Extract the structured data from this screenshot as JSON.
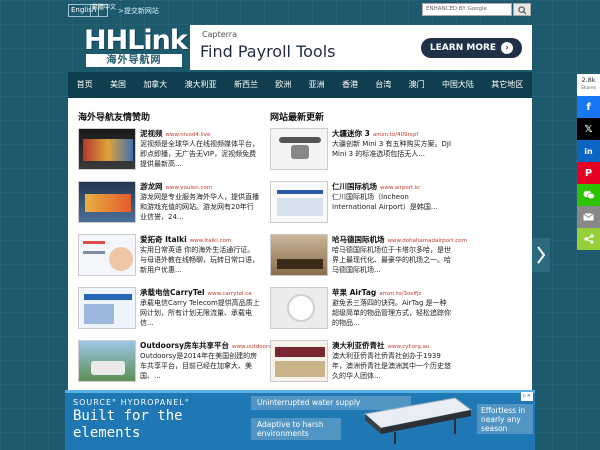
{
  "topbar": {
    "lang_en": "English",
    "lang_zh": "繁體中文",
    "submit_link": ">提交新网站",
    "search_placeholder": "ENHANCED BY Google"
  },
  "logo": {
    "main": "HHLink",
    "sub": "海外导航网"
  },
  "top_ad": {
    "brand": "Capterra",
    "headline": "Find Payroll Tools",
    "cta": "LEARN MORE"
  },
  "nav": [
    "首页",
    "美国",
    "加拿大",
    "澳大利亚",
    "新西兰",
    "欧洲",
    "亚洲",
    "香港",
    "台湾",
    "澳门",
    "中国大陆",
    "其它地区"
  ],
  "left_column": {
    "title": "海外导航友情赞助",
    "entries": [
      {
        "title": "泥视频",
        "url": "www.nivod4.live",
        "desc": "泥视频是全球华人在线视频媒体平台，即点即播，无广告无VIP，泥视频免费提供最新高..."
      },
      {
        "title": "游龙网",
        "url": "www.youlon.com",
        "desc": "游龙网是专业服务海外华人，提供直播和游戏充值的网站。游龙网有20年行业信誉，24..."
      },
      {
        "title": "爱拓奇 Italki",
        "url": "www.italki.com",
        "desc": "实用日常英语 你的海外生活通行证。与母语外教在线畅聊，玩转日常口语， 新用户优惠..."
      },
      {
        "title": "承载电信CarryTel",
        "url": "www.carrytel.ca",
        "desc": "承载电信Carry Telecom提供高品质上网计划，所有计划无限流量、承载电信..."
      },
      {
        "title": "Outdoorsy房车共享平台",
        "url": "www.outdoorsy.com",
        "desc": "Outdoorsy是2014年在美国创建的房车共享平台，目前已经在加拿大、美国、..."
      }
    ]
  },
  "right_column": {
    "title": "网站最新更新",
    "entries": [
      {
        "title": "大疆迷你 3",
        "url": "amzn.to/409rxpf",
        "desc": "大疆创新 Mini 3 有五种购买方案。DJI Mini 3 的标准选项包括无人..."
      },
      {
        "title": "仁川国际机场",
        "url": "www.airport.kr",
        "desc": "仁川国际机场（Incheon International Airport）是韩国..."
      },
      {
        "title": "哈马德国际机场",
        "url": "www.dohahamadairport.com",
        "desc": "哈马德国际机场位于卡塔尔多哈，是世界上最现代化、最豪华的机场之一。哈马德国际机场..."
      },
      {
        "title": "苹果 AirTag",
        "url": "amzn.to/3oxifjz",
        "desc": "避免丢三落四的诀窍。AirTag 是一种超级简单的物品管理方式，轻松追踪你的物品..."
      },
      {
        "title": "澳大利亚侨青社",
        "url": "www.cyf.org.au",
        "desc": "澳大利亚侨青社侨青社创办于1939年，澳洲侨青社是澳洲其中一个历史悠久的华人团体..."
      }
    ]
  },
  "share": {
    "count": "2.8k",
    "count_label": "Shares",
    "buttons": [
      "facebook-icon",
      "x-icon",
      "linkedin-icon",
      "pinterest-icon",
      "wechat-icon",
      "email-icon",
      "share-icon"
    ],
    "colors": [
      "#1877f2",
      "#000000",
      "#0a66c2",
      "#e60023",
      "#2dc100",
      "#888888",
      "#95d03a"
    ]
  },
  "bottom_ad": {
    "brand": "SOURCE° HYDROPANEL°",
    "headline": "Built for the elements",
    "pill1": "Uninterrupted water supply",
    "pill2": "Adaptive to harsh environments",
    "pill3": "Effortless in nearly any season",
    "adchoice": "▷✕"
  }
}
